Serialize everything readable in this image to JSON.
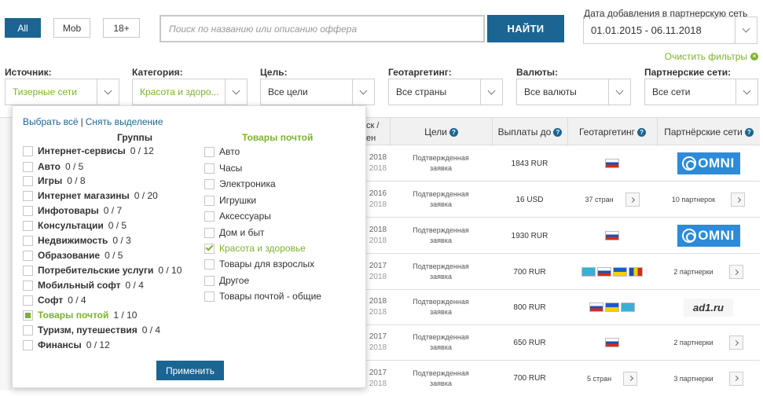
{
  "tabs": {
    "all": "All",
    "mob": "Mob",
    "adult": "18+"
  },
  "search": {
    "placeholder": "Поиск по названию или описанию оффера",
    "button": "НАЙТИ"
  },
  "date": {
    "label": "Дата добавления в партнерскую сеть",
    "value": "01.01.2015 - 06.11.2018"
  },
  "clear_filters": "Очистить фильтры",
  "filters": [
    {
      "label": "Источник:",
      "value": "Тизерные сети"
    },
    {
      "label": "Категория:",
      "value": "Красота и здоро..."
    },
    {
      "label": "Цель:",
      "value": "Все цели"
    },
    {
      "label": "Геотаргетинг:",
      "value": "Все страны"
    },
    {
      "label": "Валюты:",
      "value": "Все валюты"
    },
    {
      "label": "Партнерские сети:",
      "value": "Все сети"
    }
  ],
  "table": {
    "headers": [
      "ск /",
      "ен",
      "Цели",
      "Выплаты до",
      "Геотаргетинг",
      "Партнёрские сети"
    ],
    "rows": [
      {
        "y1": "2018",
        "y2": "2018",
        "goal1": "Подтвержденная",
        "goal2": "заявка",
        "pay": "1843 RUR",
        "net": "OMNI"
      },
      {
        "y1": "2016",
        "y2": "2018",
        "goal1": "Подтвержденная",
        "goal2": "заявка",
        "pay": "16 USD",
        "geo_text": "37 стран",
        "net_text": "10 партнерок"
      },
      {
        "y1": "2018",
        "y2": "2018",
        "goal1": "Подтвержденная",
        "goal2": "заявка",
        "pay": "1930 RUR",
        "net": "OMNI"
      },
      {
        "y1": "2017",
        "y2": "2018",
        "goal1": "Подтвержденная",
        "goal2": "заявка",
        "pay": "700 RUR",
        "net_text": "2 партнерки"
      },
      {
        "y1": "2018",
        "y2": "2018",
        "goal1": "Подтвержденная",
        "goal2": "заявка",
        "pay": "800 RUR",
        "net": "ad1.ru"
      },
      {
        "y1": "2017",
        "y2": "2018",
        "goal1": "Подтвержденная",
        "goal2": "заявка",
        "pay": "650 RUR",
        "net_text": "2 партнерки"
      },
      {
        "y1": "2017",
        "y2": "2018",
        "goal1": "Подтвержденная",
        "goal2": "заявка",
        "pay": "700 RUR",
        "geo_text": "5 стран",
        "net_text": "3 партнерки"
      }
    ]
  },
  "dropdown": {
    "select_all": "Выбрать всё",
    "separator": "|",
    "deselect": "Снять выделение",
    "groups_title": "Группы",
    "subgroup_title": "Товары почтой",
    "groups": [
      {
        "name": "Интернет-сервисы",
        "count": "0 / 12"
      },
      {
        "name": "Авто",
        "count": "0 / 5"
      },
      {
        "name": "Игры",
        "count": "0 / 8"
      },
      {
        "name": "Интернет магазины",
        "count": "0 / 20"
      },
      {
        "name": "Инфотовары",
        "count": "0 / 7"
      },
      {
        "name": "Консультации",
        "count": "0 / 5"
      },
      {
        "name": "Недвижимость",
        "count": "0 / 3"
      },
      {
        "name": "Образование",
        "count": "0 / 5"
      },
      {
        "name": "Потребительские услуги",
        "count": "0 / 10"
      },
      {
        "name": "Мобильный софт",
        "count": "0 / 4"
      },
      {
        "name": "Софт",
        "count": "0 / 4"
      },
      {
        "name": "Товары почтой",
        "count": "1 / 10"
      },
      {
        "name": "Туризм, путешествия",
        "count": "0 / 4"
      },
      {
        "name": "Финансы",
        "count": "0 / 12"
      }
    ],
    "subitems": [
      "Авто",
      "Часы",
      "Электроника",
      "Игрушки",
      "Аксессуары",
      "Дом и быт",
      "Красота и здоровье",
      "Товары для взрослых",
      "Другое",
      "Товары почтой - общие"
    ],
    "apply": "Применить"
  },
  "colors": {
    "primary": "#1b6593",
    "accent": "#7cb32b"
  }
}
